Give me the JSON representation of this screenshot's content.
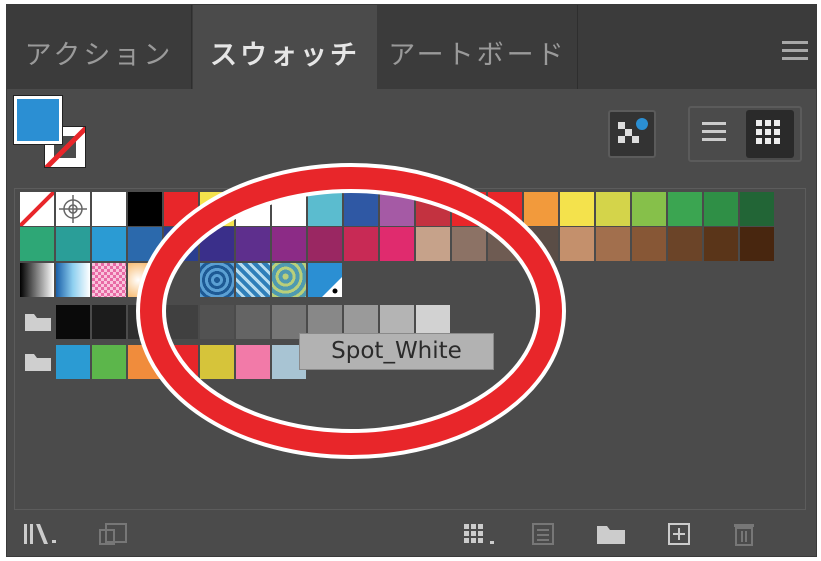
{
  "tabs": [
    {
      "label": "アクション",
      "active": false
    },
    {
      "label": "スウォッチ",
      "active": true
    },
    {
      "label": "アートボード",
      "active": false
    }
  ],
  "panel_menu_icon": "hamburger-menu-icon",
  "fill_color": "#2b8fd3",
  "stroke_state": "none",
  "view_buttons": [
    "show-swatch-kinds-icon",
    "list-view-icon",
    "grid-view-icon"
  ],
  "swatch_rows": {
    "row1": [
      "none",
      "registration",
      "#ffffff",
      "#000000",
      "#e8262a",
      "#f4e24c",
      "#ffffff",
      "#ffffff",
      "#5bbccf",
      "#2f58a4",
      "#a55aa5",
      "#c33240",
      "#e8262a",
      "#e8262a",
      "#f29a3c",
      "#f4e24c",
      "#d4d44a",
      "#86c04a",
      "#3ba551",
      "#2f8f46",
      "#226536"
    ],
    "row2": [
      "#2ea776",
      "#2a9e98",
      "#2b9bd3",
      "#2b69ac",
      "#2a3f8f",
      "#3a2f8a",
      "#5e2f8d",
      "#8c2b86",
      "#9a2762",
      "#c82a55",
      "#e02b6e",
      "#c6a28a",
      "#8c7265",
      "#6e5b52",
      "#5a4d46",
      "#c4906c",
      "#a26f4d",
      "#875736",
      "#6b4428",
      "#5a3519",
      "#48260f"
    ],
    "row3": [
      "gradient-black-white",
      "gradient-blue",
      "pattern-pink",
      "gradient-orange",
      "",
      "pattern-blue-1",
      "pattern-blue-2",
      "pattern-teal",
      "spot-blue"
    ],
    "group1": [
      "#0a0a0a",
      "#1c1c1c",
      "#2e2e2e",
      "#404040",
      "#525252",
      "#646464",
      "#767676",
      "#888888",
      "#9a9a9a",
      "#b4b4b4",
      "#d2d2d2"
    ],
    "group2": [
      "#2b9bd3",
      "#5cb64b",
      "#f08c3c",
      "#e8262a",
      "#d6c43a",
      "#f27aa8",
      "#a8c4d3"
    ]
  },
  "tooltip": "Spot_White",
  "annotation_color": "#e8262a",
  "footer_icons": [
    "swatch-libraries-menu-icon",
    "place-swatches-icon",
    "swatch-kinds-menu-icon",
    "swatch-options-icon",
    "new-color-group-icon",
    "new-swatch-icon",
    "delete-swatch-icon"
  ]
}
